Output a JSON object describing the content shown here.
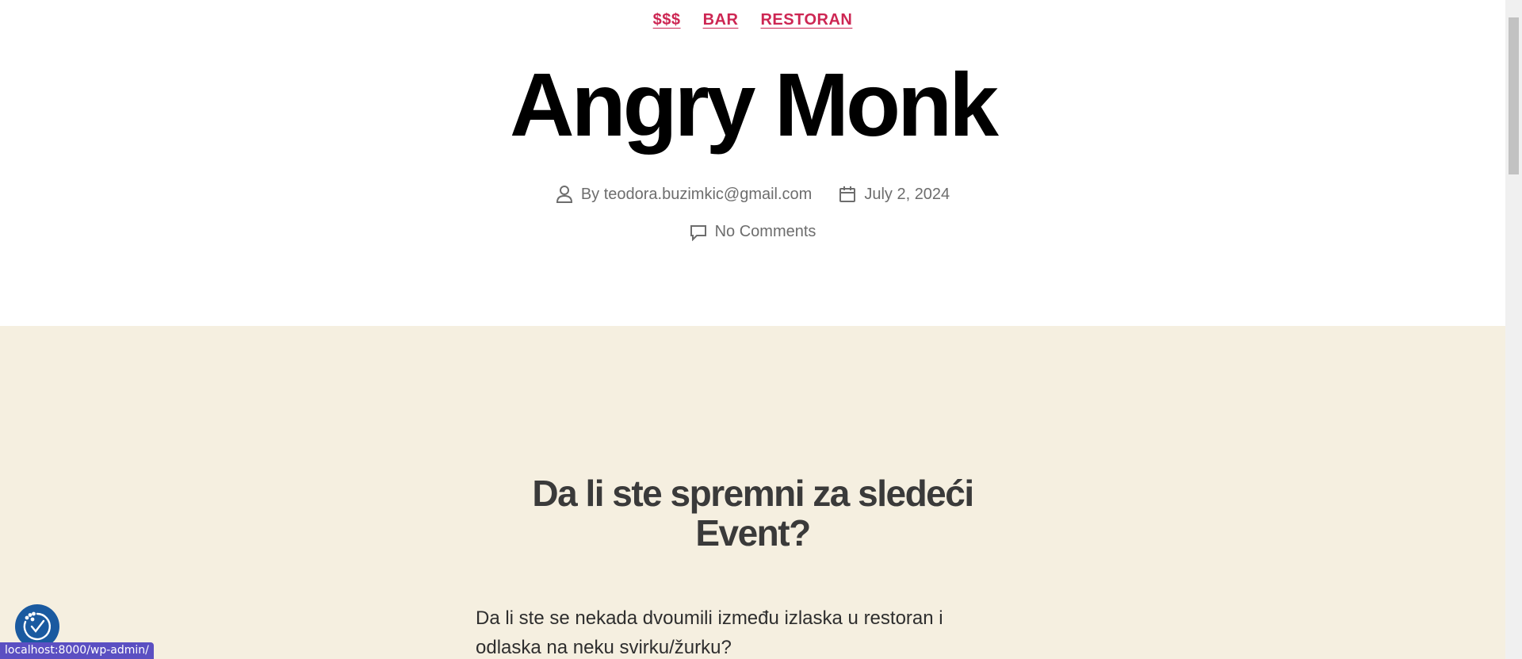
{
  "post": {
    "categories": [
      "$$$",
      "BAR",
      "RESTORAN"
    ],
    "title": "Angry Monk",
    "author": "By teodora.buzimkic@gmail.com",
    "date": "July 2, 2024",
    "comments": "No Comments"
  },
  "content": {
    "heading_line1": "Da li ste spremni za sledeći",
    "heading_line2": "Event?",
    "paragraph_line1": "Da li ste se nekada dvoumili između izlaska u restoran i",
    "paragraph_line2": "odlaska na neku svirku/žurku?"
  },
  "status_bar": {
    "url": "localhost:8000/wp-admin/"
  },
  "colors": {
    "accent": "#cd2653",
    "content_bg": "#f5efe0",
    "a11y_button": "#1a5aa0",
    "status_bg": "#5b4fc2"
  },
  "icons": {
    "author": "user-icon",
    "date": "calendar-icon",
    "comments": "comment-icon",
    "accessibility": "accessibility-icon"
  }
}
